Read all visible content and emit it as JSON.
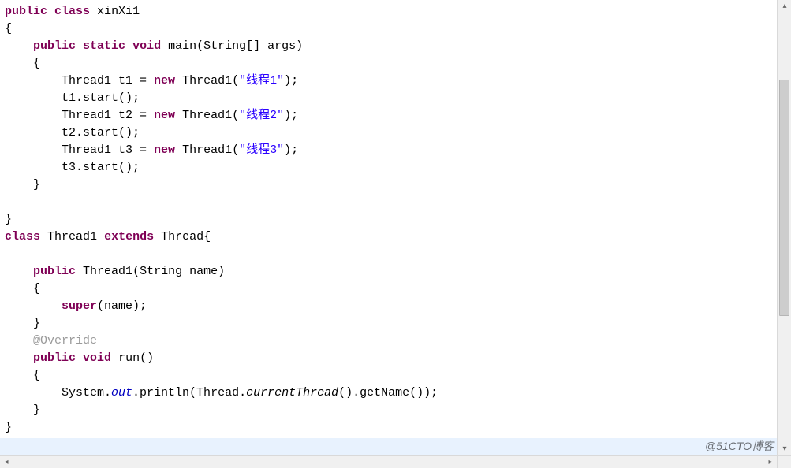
{
  "code": {
    "class_decl": {
      "kw_public": "public",
      "kw_class": "class",
      "name": "xinXi1"
    },
    "main": {
      "kw_public": "public",
      "kw_static": "static",
      "kw_void": "void",
      "name": "main",
      "params_prefix": "(String[] ",
      "param_name": "args",
      "params_suffix": ")",
      "lines": {
        "t1_decl_pre": "Thread1 t1 = ",
        "kw_new1": "new",
        "t1_ctor": " Thread1(",
        "t1_arg": "\"线程1\"",
        "t1_end": ");",
        "t1_start": "t1.start();",
        "t2_decl_pre": "Thread1 t2 = ",
        "kw_new2": "new",
        "t2_ctor": " Thread1(",
        "t2_arg": "\"线程2\"",
        "t2_end": ");",
        "t2_start": "t2.start();",
        "t3_decl_pre": "Thread1 t3 = ",
        "kw_new3": "new",
        "t3_ctor": " Thread1(",
        "t3_arg": "\"线程3\"",
        "t3_end": ");",
        "t3_start": "t3.start();"
      }
    },
    "class2_decl": {
      "kw_class": "class",
      "name": "Thread1",
      "kw_extends": "extends",
      "super": "Thread"
    },
    "ctor": {
      "kw_public": "public",
      "name": "Thread1",
      "params": "(String name)",
      "body_kw_super": "super",
      "body_rest": "(name);"
    },
    "override": "@Override",
    "run": {
      "kw_public": "public",
      "kw_void": "void",
      "name": "run",
      "params": "()",
      "stmt_obj": "System.",
      "stmt_out": "out",
      "stmt_mid": ".println(Thread.",
      "stmt_cur": "currentThread",
      "stmt_tail": "().getName());"
    }
  },
  "watermark": "@51CTO博客"
}
